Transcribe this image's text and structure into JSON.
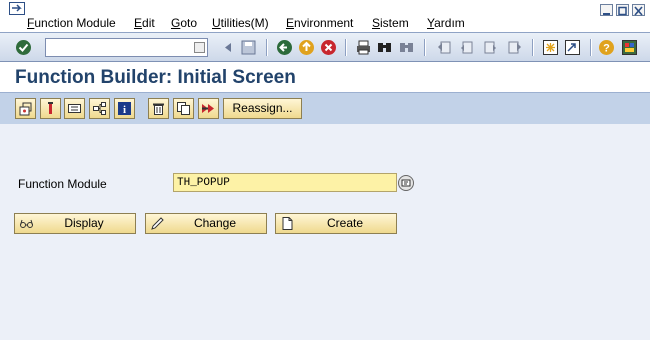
{
  "menubar": {
    "items": [
      {
        "underline": "F",
        "rest": "unction Module"
      },
      {
        "underline": "E",
        "rest": "dit"
      },
      {
        "underline": "G",
        "rest": "oto"
      },
      {
        "underline": "U",
        "rest": "tilities(M)"
      },
      {
        "underline": "E",
        "rest": "nvironment"
      },
      {
        "underline": "S",
        "rest": "istem"
      },
      {
        "underline": "Y",
        "rest": "ardım"
      }
    ]
  },
  "toolbar": {
    "command_field_value": "",
    "icons": [
      "enter-icon",
      "save-icon",
      "back-icon",
      "exit-icon",
      "cancel-icon",
      "print-icon",
      "find-icon",
      "find-next-icon",
      "first-page-icon",
      "previous-page-icon",
      "next-page-icon",
      "last-page-icon",
      "create-session-icon",
      "shortcut-icon",
      "help-icon",
      "customize-layout-icon"
    ]
  },
  "title": "Function Builder: Initial Screen",
  "app_toolbar": {
    "reassign_label": "Reassign..."
  },
  "form": {
    "function_module_label": "Function Module",
    "function_module_value": "TH_POPUP"
  },
  "actions": {
    "display_label": "Display",
    "change_label": "Change",
    "create_label": "Create"
  },
  "colors": {
    "title": "#22436b",
    "input_bg": "#fdf2a6",
    "button_bg": "#efd98e",
    "app_toolbar_bg": "#c2d2e8",
    "main_bg": "#ecf0f8"
  }
}
